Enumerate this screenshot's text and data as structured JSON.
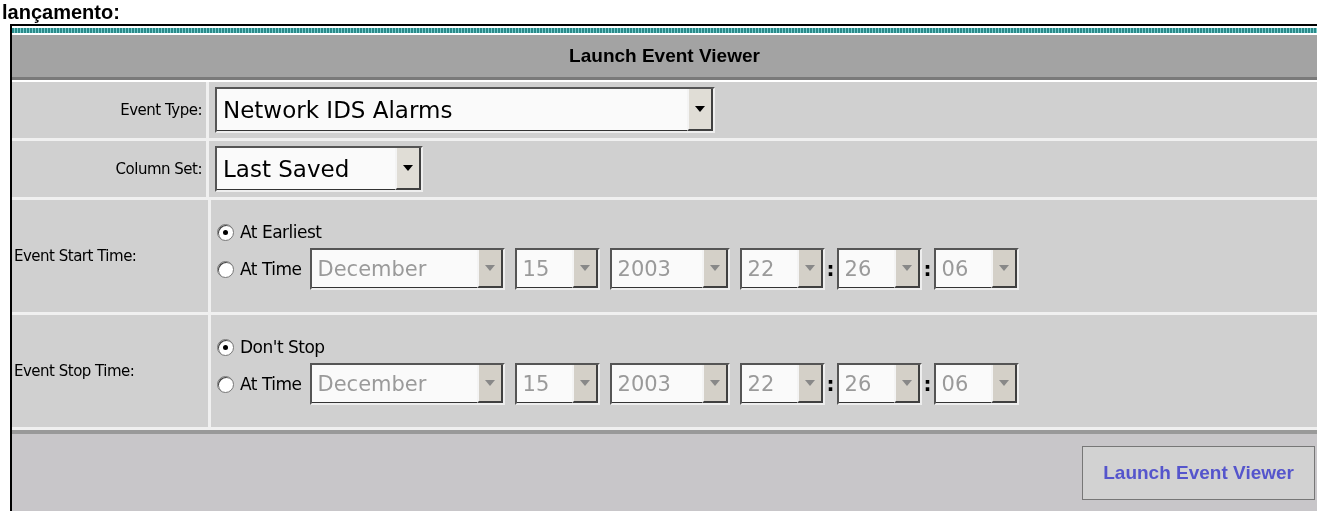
{
  "heading": "lançamento:",
  "panel": {
    "title": "Launch Event Viewer"
  },
  "fields": [
    {
      "kind": "select",
      "label": "Event Type:",
      "value": "Network IDS Alarms",
      "disabled": false
    },
    {
      "kind": "select",
      "label": "Column Set:",
      "value": "Last Saved",
      "disabled": false
    },
    {
      "kind": "time",
      "label": "Event Start Time:",
      "options": [
        {
          "label": "At Earliest",
          "selected": true
        },
        {
          "label": "At Time",
          "selected": false,
          "parts": [
            {
              "value": "December",
              "disabled": true
            },
            {
              "value": "15",
              "disabled": true
            },
            {
              "value": "2003",
              "disabled": true
            },
            {
              "value": "22",
              "disabled": true
            },
            {
              "sep": ":",
              "value": "26",
              "disabled": true
            },
            {
              "sep": ":",
              "value": "06",
              "disabled": true
            }
          ]
        }
      ]
    },
    {
      "kind": "time",
      "label": "Event Stop Time:",
      "options": [
        {
          "label": "Don't Stop",
          "selected": true
        },
        {
          "label": "At Time",
          "selected": false,
          "parts": [
            {
              "value": "December",
              "disabled": true
            },
            {
              "value": "15",
              "disabled": true
            },
            {
              "value": "2003",
              "disabled": true
            },
            {
              "value": "22",
              "disabled": true
            },
            {
              "sep": ":",
              "value": "26",
              "disabled": true
            },
            {
              "sep": ":",
              "value": "06",
              "disabled": true
            }
          ]
        }
      ]
    }
  ],
  "button": "Launch Event Viewer"
}
